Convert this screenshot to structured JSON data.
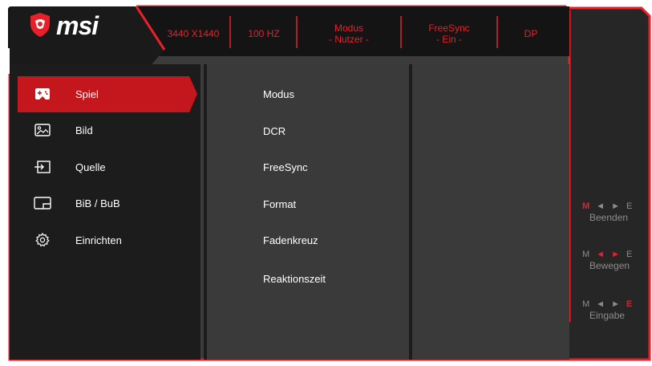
{
  "brand": "msi",
  "status_bar": {
    "resolution": "3440 X1440",
    "refresh": "100 HZ",
    "mode_title": "Modus",
    "mode_value": "- Nutzer -",
    "freesync_title": "FreeSync",
    "freesync_value": "- Ein -",
    "input": "DP"
  },
  "menu": {
    "items": [
      {
        "label": "Spiel",
        "icon": "gamepad-icon",
        "selected": true
      },
      {
        "label": "Bild",
        "icon": "image-icon",
        "selected": false
      },
      {
        "label": "Quelle",
        "icon": "input-source-icon",
        "selected": false
      },
      {
        "label": "BiB / BuB",
        "icon": "pip-icon",
        "selected": false
      },
      {
        "label": "Einrichten",
        "icon": "settings-gear-icon",
        "selected": false
      }
    ]
  },
  "submenu": {
    "items": [
      "Modus",
      "DCR",
      "FreeSync",
      "Format",
      "Fadenkreuz",
      "Reaktionszeit"
    ]
  },
  "hints": {
    "exit": {
      "label": "Beenden",
      "keys": [
        "M",
        "◄",
        "►",
        "E"
      ],
      "active": "M"
    },
    "move": {
      "label": "Bewegen",
      "keys": [
        "M",
        "◄",
        "►",
        "E"
      ],
      "active": "arrows"
    },
    "enter": {
      "label": "Eingabe",
      "keys": [
        "M",
        "◄",
        "►",
        "E"
      ],
      "active": "E"
    }
  },
  "colors": {
    "accent": "#e8202a",
    "panel": "#3a3a3a",
    "dark": "#1e1e1e",
    "text": "#ffffff",
    "muted": "#8c8c8c"
  }
}
